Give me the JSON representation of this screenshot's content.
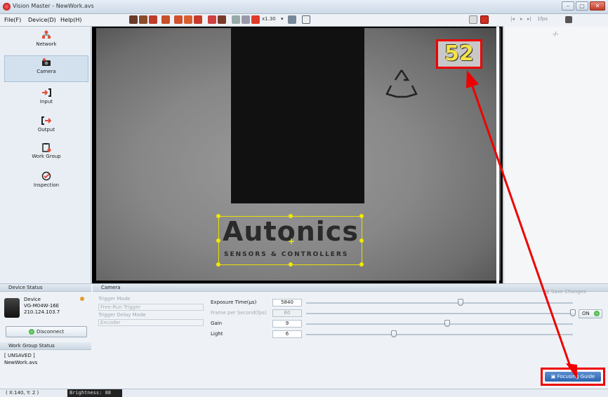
{
  "window": {
    "title": "Vision Master - NewWork.avs"
  },
  "menu": {
    "items": [
      "File(F)",
      "Device(D)",
      "Help(H)"
    ]
  },
  "toolbar": {
    "zoom": "x1.30",
    "fps": "1fps"
  },
  "sidebar": {
    "items": [
      {
        "label": "Network",
        "icon": "network-icon"
      },
      {
        "label": "Camera",
        "icon": "camera-icon",
        "active": true
      },
      {
        "label": "Input",
        "icon": "input-arrow-icon"
      },
      {
        "label": "Output",
        "icon": "output-arrow-icon"
      },
      {
        "label": "Work Group",
        "icon": "clipboard-icon"
      },
      {
        "label": "Inspection",
        "icon": "check-circle-icon"
      }
    ]
  },
  "viewer": {
    "frame_number": "52",
    "logo_text": "Autonics",
    "logo_sub": "SENSORS & CONTROLLERS"
  },
  "right_panel": {
    "placeholder": "-/-"
  },
  "device_status": {
    "header": "Device Status",
    "label": "Device",
    "model": "VG-M04W-16E",
    "ip": "210.124.103.7",
    "disconnect": "Disconnect"
  },
  "work_group_status": {
    "header": "Work Group Status",
    "state": "[ UNSAVED ]",
    "file": "NewWork.avs"
  },
  "camera_panel": {
    "header": "Camera",
    "trigger_mode_label": "Trigger Mode",
    "trigger_mode_value": "Free-Run Trigger",
    "trigger_delay_label": "Trigger Delay Mode",
    "trigger_delay_value": "Encoder",
    "params": [
      {
        "label": "Exposure Time(μs)",
        "value": "5840",
        "level": 0.58,
        "disabled": false
      },
      {
        "label": "Frame per Second(fps)",
        "value": "60",
        "level": 1.0,
        "disabled": true
      },
      {
        "label": "Gain",
        "value": "9",
        "level": 0.53,
        "disabled": false
      },
      {
        "label": "Light",
        "value": "6",
        "level": 0.33,
        "disabled": false
      }
    ],
    "light_toggle": "ON",
    "save_changes": "Save Changes",
    "focusing_guide": "Focusing Guide"
  },
  "status_bar": {
    "coords": "( X:140,  Y:  2 )",
    "brightness": "Brightness: 88"
  },
  "colors": {
    "highlight": "#e00000",
    "roi": "#e8e000",
    "accent": "#2c64b0"
  }
}
